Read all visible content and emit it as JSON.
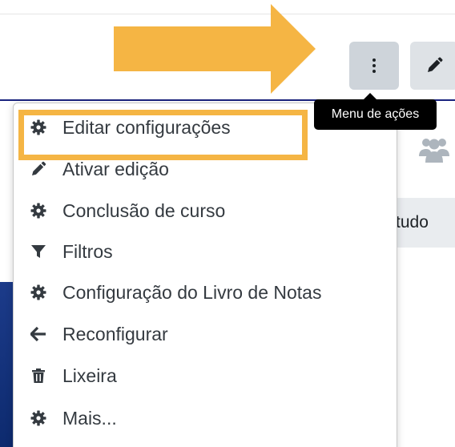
{
  "header": {
    "tooltip": "Menu de ações",
    "tab_partial": "tudo"
  },
  "menu": {
    "items": [
      {
        "label": "Editar configurações",
        "icon": "gear-icon"
      },
      {
        "label": "Ativar edição",
        "icon": "pencil-icon"
      },
      {
        "label": "Conclusão de curso",
        "icon": "gear-icon"
      },
      {
        "label": "Filtros",
        "icon": "filter-icon"
      },
      {
        "label": "Configuração do Livro de Notas",
        "icon": "gear-icon"
      },
      {
        "label": "Reconfigurar",
        "icon": "arrow-left-icon"
      },
      {
        "label": "Lixeira",
        "icon": "trash-icon"
      },
      {
        "label": "Mais...",
        "icon": "gear-icon"
      }
    ]
  },
  "colors": {
    "accent": "#f5b544",
    "header_border": "#1a237e",
    "tooltip_bg": "#000000"
  }
}
